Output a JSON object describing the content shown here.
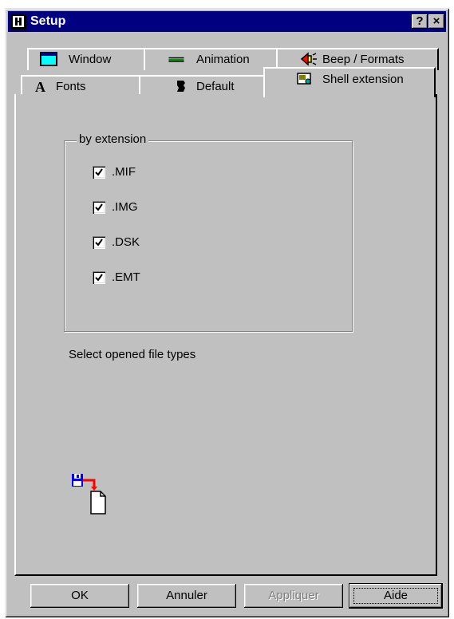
{
  "window": {
    "title": "Setup",
    "help_btn": "?",
    "close_btn": "×"
  },
  "tabs_back": [
    {
      "label": "Window",
      "icon": "window-icon"
    },
    {
      "label": "Animation",
      "icon": "animation-icon"
    },
    {
      "label": "Beep / Formats",
      "icon": "speaker-icon"
    }
  ],
  "tabs_front": [
    {
      "label": "Fonts",
      "icon": "font-icon"
    },
    {
      "label": "Default",
      "icon": "default-icon"
    },
    {
      "label": "Shell extension",
      "icon": "shell-extension-icon",
      "active": true
    }
  ],
  "group": {
    "legend": "by extension",
    "items": [
      {
        "label": ".MIF",
        "checked": true
      },
      {
        "label": ".IMG",
        "checked": true
      },
      {
        "label": ".DSK",
        "checked": true
      },
      {
        "label": ".EMT",
        "checked": true
      }
    ]
  },
  "hint": "Select opened file types",
  "buttons": {
    "ok": "OK",
    "cancel": "Annuler",
    "apply": "Appliquer",
    "help": "Aide"
  },
  "colors": {
    "titlebar": "#000080",
    "face": "#c0c0c0"
  }
}
